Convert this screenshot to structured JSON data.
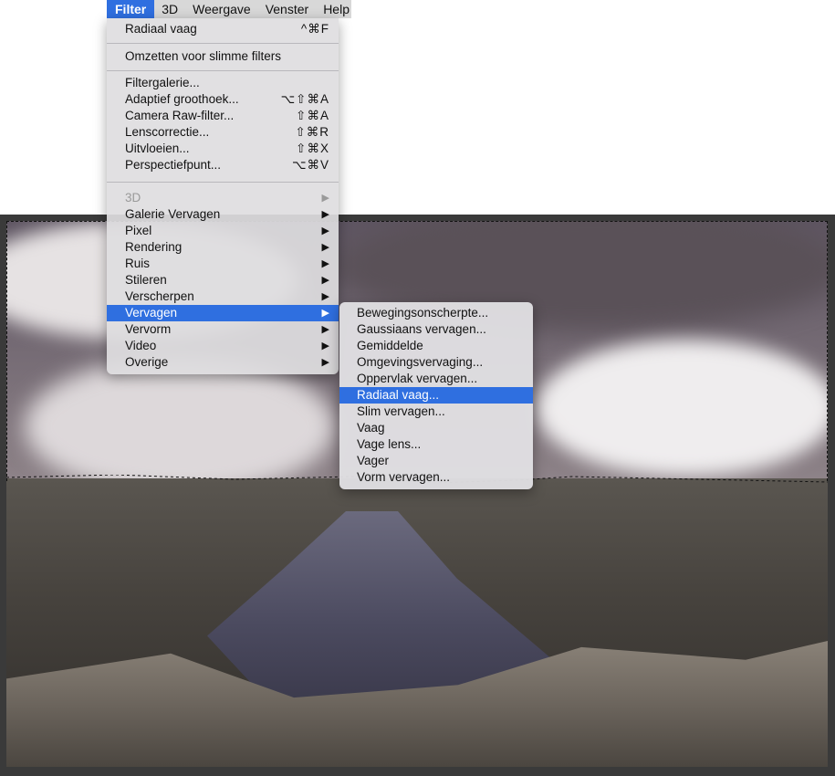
{
  "menubar": {
    "items": [
      {
        "label": "Filter"
      },
      {
        "label": "3D"
      },
      {
        "label": "Weergave"
      },
      {
        "label": "Venster"
      },
      {
        "label": "Help"
      }
    ]
  },
  "filter_menu": {
    "recent": {
      "label": "Radiaal vaag",
      "shortcut": "^⌘F"
    },
    "smart": {
      "label": "Omzetten voor slimme filters"
    },
    "gallery_group": [
      {
        "label": "Filtergalerie...",
        "shortcut": ""
      },
      {
        "label": "Adaptief groothoek...",
        "shortcut": "⌥⇧⌘A"
      },
      {
        "label": "Camera Raw-filter...",
        "shortcut": "⇧⌘A"
      },
      {
        "label": "Lenscorrectie...",
        "shortcut": "⇧⌘R"
      },
      {
        "label": "Uitvloeien...",
        "shortcut": "⇧⌘X"
      },
      {
        "label": "Perspectiefpunt...",
        "shortcut": "⌥⌘V"
      }
    ],
    "submenu_group": [
      {
        "label": "3D",
        "disabled": true
      },
      {
        "label": "Galerie Vervagen"
      },
      {
        "label": "Pixel"
      },
      {
        "label": "Rendering"
      },
      {
        "label": "Ruis"
      },
      {
        "label": "Stileren"
      },
      {
        "label": "Verscherpen"
      },
      {
        "label": "Vervagen",
        "highlighted": true
      },
      {
        "label": "Vervorm"
      },
      {
        "label": "Video"
      },
      {
        "label": "Overige"
      }
    ],
    "arrow_glyph": "▶"
  },
  "blur_submenu": {
    "items": [
      {
        "label": "Bewegingsonscherpte..."
      },
      {
        "label": "Gaussiaans vervagen..."
      },
      {
        "label": "Gemiddelde"
      },
      {
        "label": "Omgevingsvervaging..."
      },
      {
        "label": "Oppervlak vervagen..."
      },
      {
        "label": "Radiaal vaag...",
        "highlighted": true
      },
      {
        "label": "Slim vervagen..."
      },
      {
        "label": "Vaag"
      },
      {
        "label": "Vage lens..."
      },
      {
        "label": "Vager"
      },
      {
        "label": "Vorm vervagen..."
      }
    ]
  },
  "colors": {
    "highlight": "#2f6fe0",
    "menubar_bg": "#d8d8d8",
    "menu_bg": "#dedde0"
  }
}
